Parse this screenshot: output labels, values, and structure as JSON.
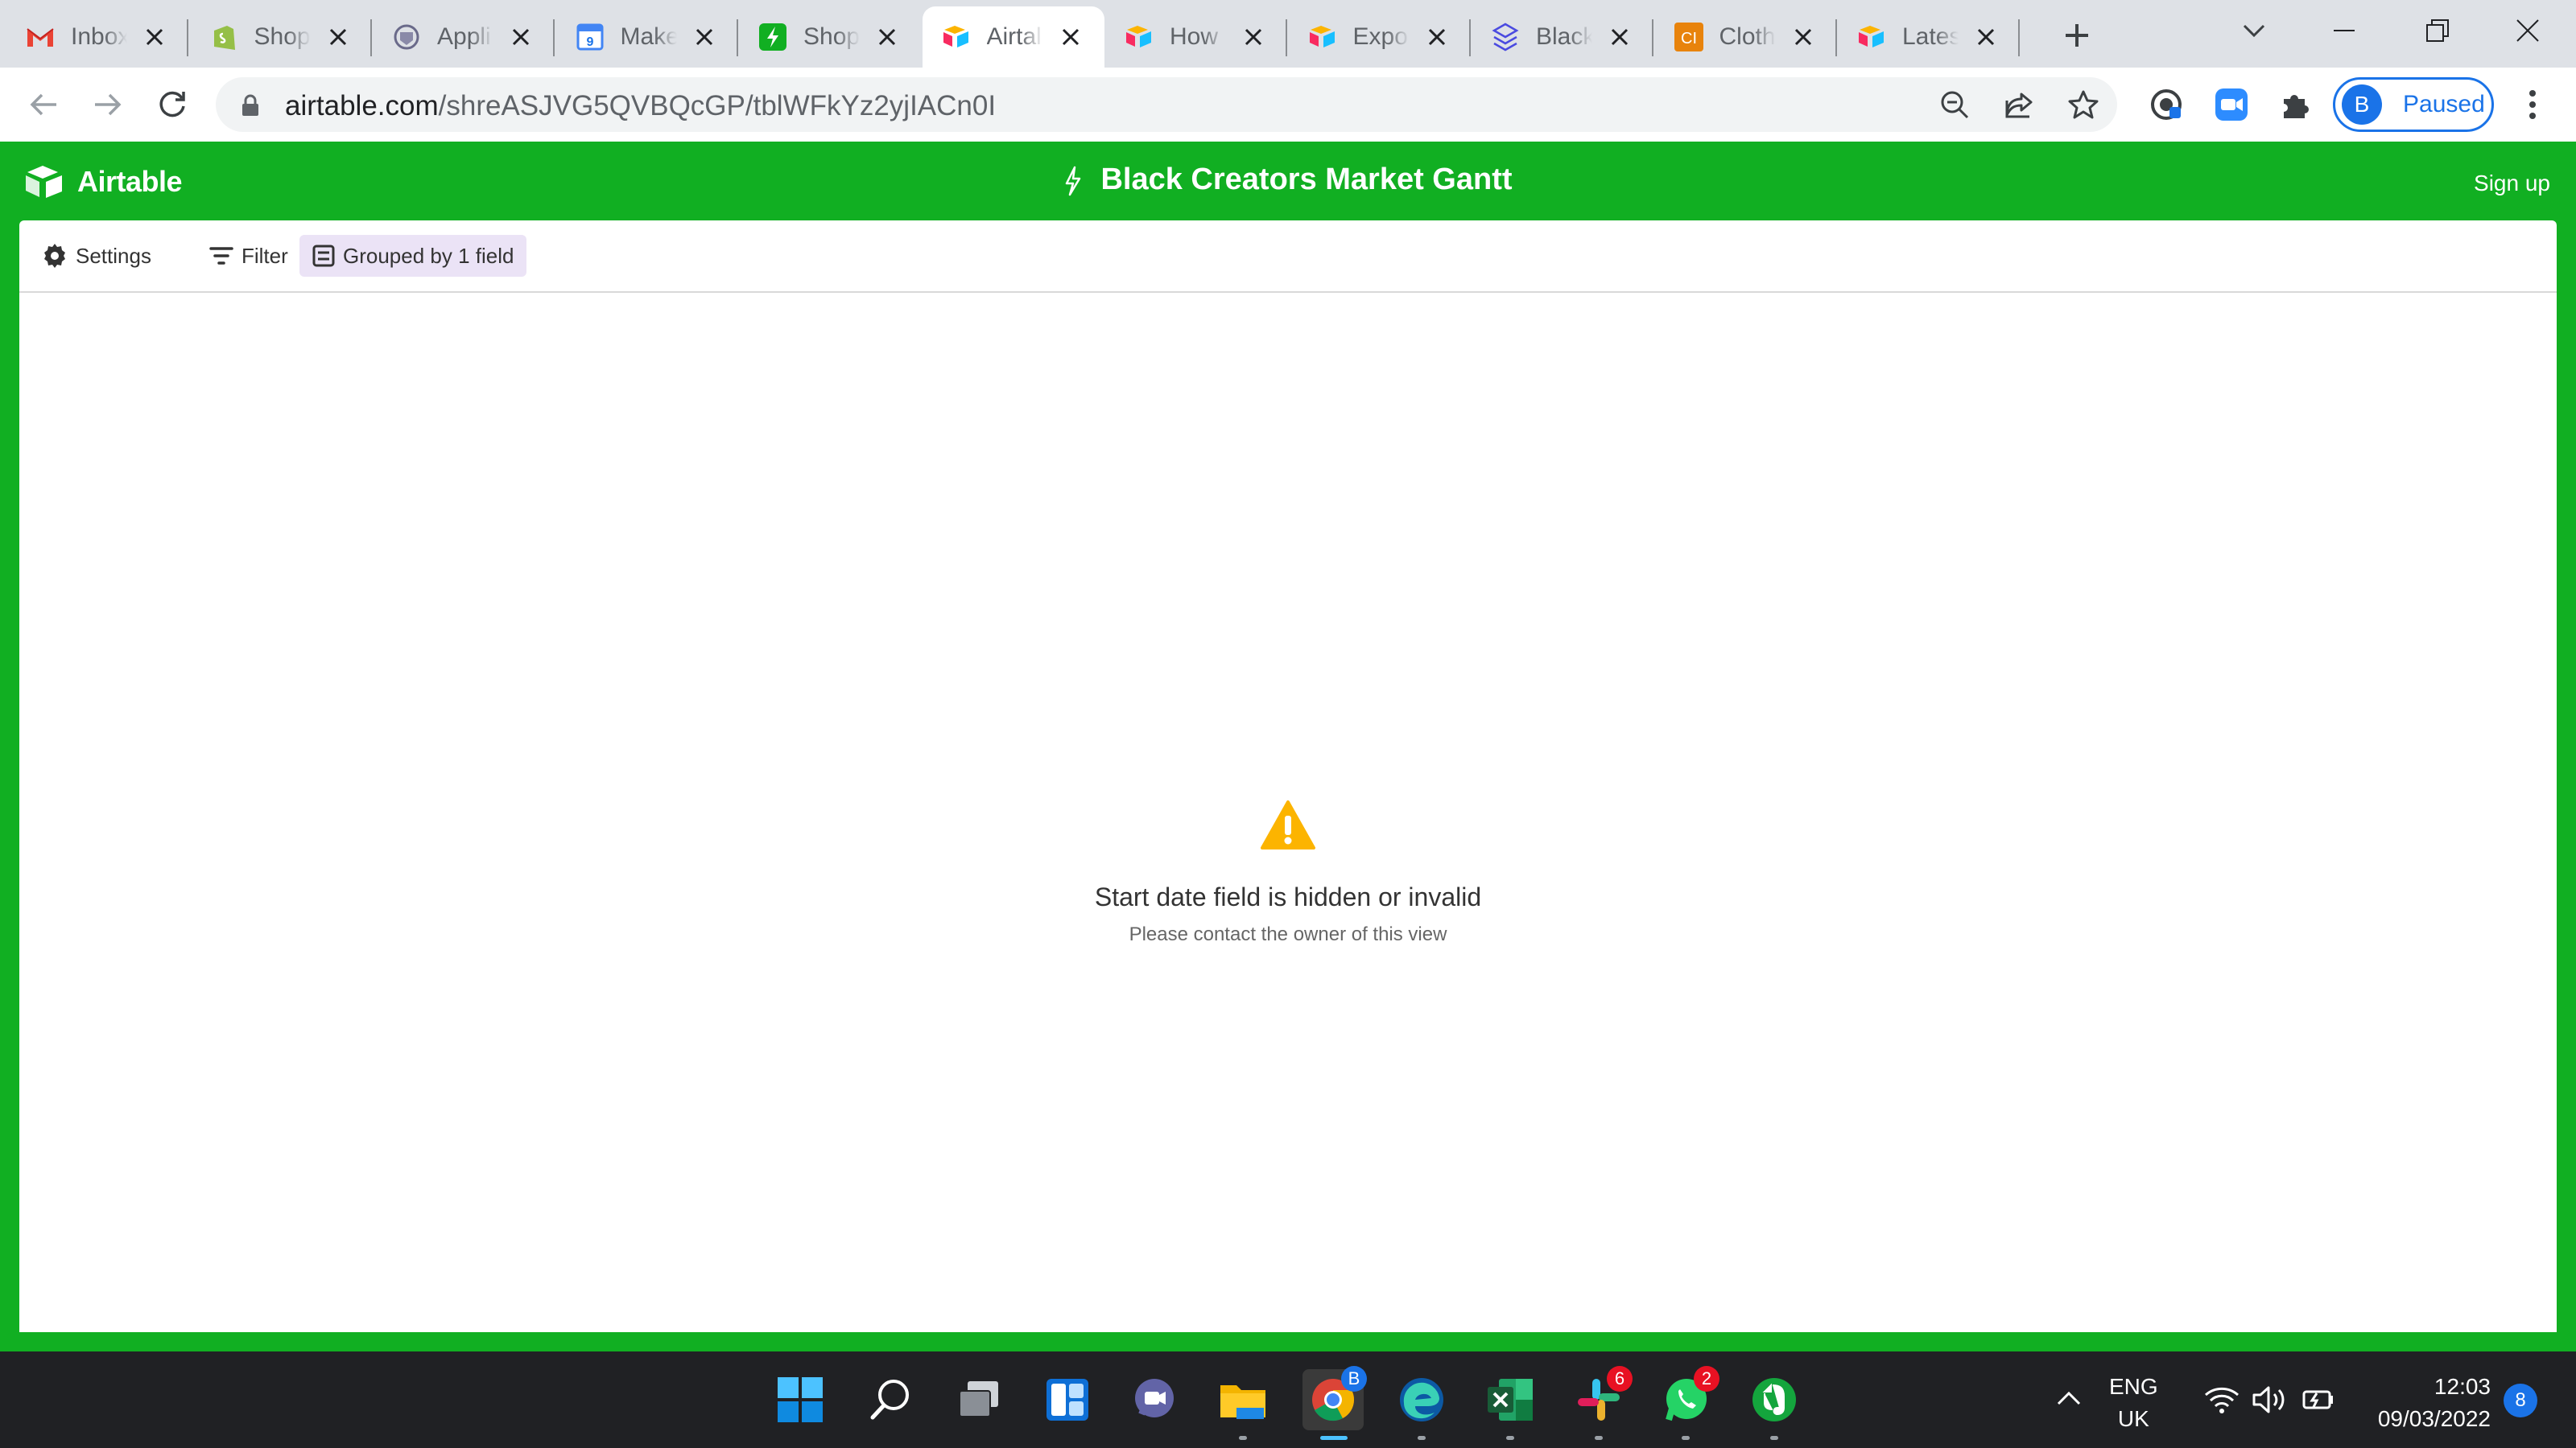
{
  "browser": {
    "tabs": [
      {
        "label": "Inbox",
        "icon": "gmail-icon"
      },
      {
        "label": "Shop",
        "icon": "shopify-icon"
      },
      {
        "label": "Appli",
        "icon": "crest-icon"
      },
      {
        "label": "Make",
        "icon": "calendar-icon"
      },
      {
        "label": "Shop",
        "icon": "bolt-icon"
      },
      {
        "label": "Airtal",
        "icon": "airtable-icon",
        "active": true
      },
      {
        "label": "How",
        "icon": "airtable-icon"
      },
      {
        "label": "Expo",
        "icon": "airtable-icon"
      },
      {
        "label": "Black",
        "icon": "softr-icon"
      },
      {
        "label": "Cloth",
        "icon": "ci-icon"
      },
      {
        "label": "Lates",
        "icon": "airtable-icon"
      }
    ],
    "url_host": "airtable.com",
    "url_path": "/shreASJVG5QVBQcGP/tblWFkYz2yjIACn0I",
    "profile_initial": "B",
    "profile_status": "Paused"
  },
  "airtable": {
    "logo_text": "Airtable",
    "base_title": "Black Creators Market Gantt",
    "sign_up": "Sign up",
    "toolbar": {
      "settings": "Settings",
      "filter": "Filter",
      "grouped": "Grouped by 1 field"
    },
    "empty_state": {
      "message": "Start date field is hidden or invalid",
      "sub": "Please contact the owner of this view"
    }
  },
  "taskbar": {
    "badges": {
      "browser": "B",
      "slack": "6",
      "whatsapp": "2"
    },
    "lang_top": "ENG",
    "lang_bottom": "UK",
    "time": "12:03",
    "date": "09/03/2022",
    "notifications": "8"
  },
  "colors": {
    "airtable_green": "#11af22",
    "chrome_tabstrip": "#dee1e6",
    "taskbar": "#202124",
    "warning": "#fcb400",
    "accent_blue": "#1a73e8"
  }
}
